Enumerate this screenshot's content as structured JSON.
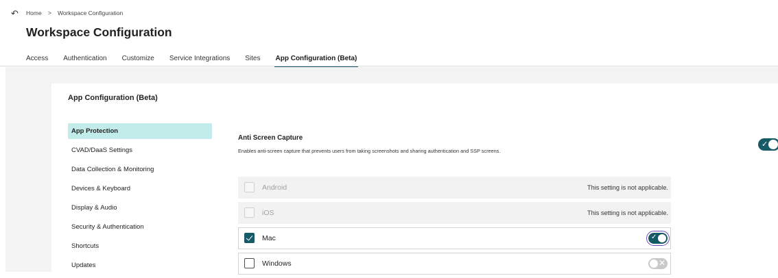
{
  "nav": {
    "back_icon": "back-arrow-icon",
    "back_glyph": "↶"
  },
  "breadcrumb": {
    "items": [
      "Home",
      "Workspace Configuration"
    ],
    "separator": ">"
  },
  "page": {
    "title": "Workspace Configuration"
  },
  "tabs": [
    {
      "label": "Access",
      "active": false
    },
    {
      "label": "Authentication",
      "active": false
    },
    {
      "label": "Customize",
      "active": false
    },
    {
      "label": "Service Integrations",
      "active": false
    },
    {
      "label": "Sites",
      "active": false
    },
    {
      "label": "App Configuration (Beta)",
      "active": true
    }
  ],
  "card": {
    "title": "App Configuration (Beta)"
  },
  "sidebar": {
    "items": [
      {
        "label": "App Protection",
        "active": true
      },
      {
        "label": "CVAD/DaaS Settings",
        "active": false
      },
      {
        "label": "Data Collection & Monitoring",
        "active": false
      },
      {
        "label": "Devices & Keyboard",
        "active": false
      },
      {
        "label": "Display & Audio",
        "active": false
      },
      {
        "label": "Security & Authentication",
        "active": false
      },
      {
        "label": "Shortcuts",
        "active": false
      },
      {
        "label": "Updates",
        "active": false
      }
    ]
  },
  "setting": {
    "title": "Anti Screen Capture",
    "description": "Enables anti-screen capture that prevents users from taking screenshots and sharing authentication and SSP screens.",
    "enabled": true,
    "toggle_check_glyph": "✓"
  },
  "platforms": [
    {
      "label": "Android",
      "applicable": false,
      "checked": false,
      "note": "This setting is not applicable."
    },
    {
      "label": "iOS",
      "applicable": false,
      "checked": false,
      "note": "This setting is not applicable."
    },
    {
      "label": "Mac",
      "applicable": true,
      "checked": true,
      "toggle": "on"
    },
    {
      "label": "Windows",
      "applicable": true,
      "checked": false,
      "toggle": "off"
    }
  ],
  "colors": {
    "accent": "#155a66",
    "active_nav_bg": "#c1ece9",
    "focus_outline": "#6b4bbd"
  }
}
